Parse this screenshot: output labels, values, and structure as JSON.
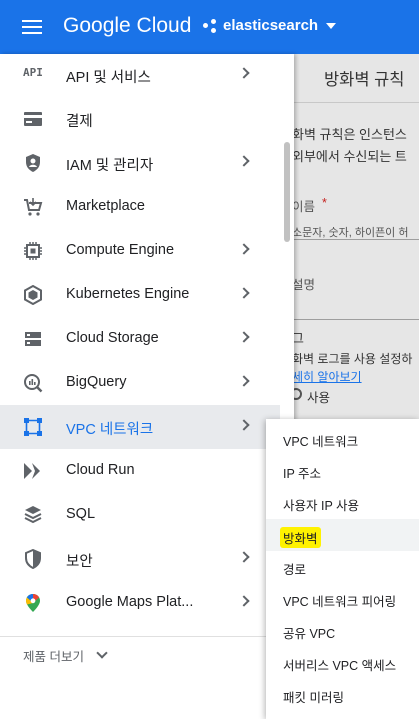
{
  "header": {
    "brand": "Google Cloud",
    "project": "elasticsearch"
  },
  "background_page": {
    "title": "방화벽 규칙",
    "desc_line1": "화벽 규칙은 인스턴스",
    "desc_line2": "외부에서 수신되는 트",
    "name_label": "이름",
    "required_mark": "*",
    "name_hint": "소문자, 숫자, 하이픈이 허",
    "desc_label": "설명",
    "logs_heading": "그",
    "logs_text": "화벽 로그를 사용 설정하",
    "learn_more": "세히 알아보기",
    "radio_label": "사용"
  },
  "nav": {
    "items": [
      {
        "label": "API 및 서비스",
        "icon": "api-icon",
        "chevron": true
      },
      {
        "label": "결제",
        "icon": "billing-icon",
        "chevron": false
      },
      {
        "label": "IAM 및 관리자",
        "icon": "shield-icon",
        "chevron": true
      },
      {
        "label": "Marketplace",
        "icon": "cart-icon",
        "chevron": false
      },
      {
        "label": "Compute Engine",
        "icon": "chip-icon",
        "chevron": true
      },
      {
        "label": "Kubernetes Engine",
        "icon": "hexagon-icon",
        "chevron": true
      },
      {
        "label": "Cloud Storage",
        "icon": "storage-icon",
        "chevron": true
      },
      {
        "label": "BigQuery",
        "icon": "bigquery-icon",
        "chevron": true
      },
      {
        "label": "VPC 네트워크",
        "icon": "vpc-icon",
        "chevron": true
      },
      {
        "label": "Cloud Run",
        "icon": "run-icon",
        "chevron": false
      },
      {
        "label": "SQL",
        "icon": "sql-icon",
        "chevron": false
      },
      {
        "label": "보안",
        "icon": "security-shield-icon",
        "chevron": true
      },
      {
        "label": "Google Maps Plat...",
        "icon": "maps-pin-icon",
        "chevron": true
      }
    ],
    "more_label": "제품 더보기",
    "api_icon_text": "API"
  },
  "submenu": {
    "items": [
      {
        "label": "VPC 네트워크"
      },
      {
        "label": "IP 주소"
      },
      {
        "label": "사용자 IP 사용"
      },
      {
        "label": "방화벽"
      },
      {
        "label": "경로"
      },
      {
        "label": "VPC 네트워크 피어링"
      },
      {
        "label": "공유 VPC"
      },
      {
        "label": "서버리스 VPC 액세스"
      },
      {
        "label": "패킷 미러링"
      }
    ]
  },
  "colors": {
    "topbar": "#1a73e8",
    "active_text": "#1a73e8",
    "highlight": "#fff200"
  }
}
